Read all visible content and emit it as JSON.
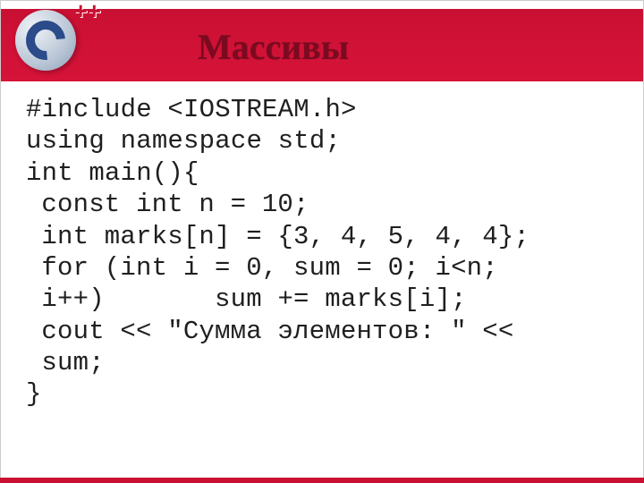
{
  "header": {
    "logo_plus": "++",
    "title": "Массивы"
  },
  "code": {
    "l1": "#include <IOSTREAM.h>",
    "l2": "using namespace std;",
    "l3": "int main(){",
    "l4": "const int n = 10;",
    "l5": "int marks[n] = {3, 4, 5, 4, 4};",
    "l6": "for (int i = 0, sum = 0; i<n;",
    "l7a": "i++)",
    "l7b": "       sum += marks[i];",
    "l8": "cout << \"Сумма элементов: \" <<",
    "l9": "sum;",
    "l10": "}"
  },
  "footer_mark": ""
}
